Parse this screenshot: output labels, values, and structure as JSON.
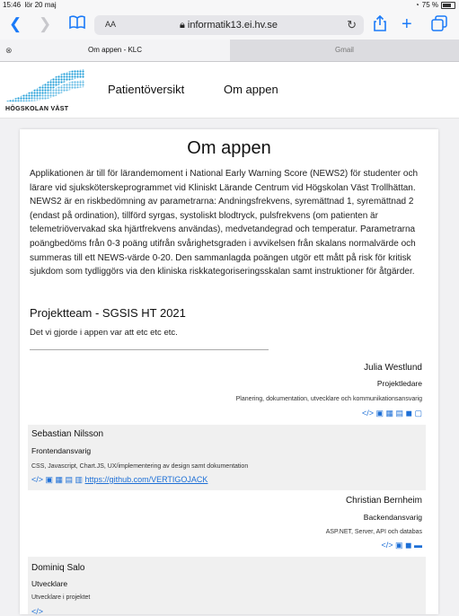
{
  "status_bar": {
    "time": "15:46",
    "date": "lör 20 maj",
    "battery": "75 %"
  },
  "toolbar": {
    "text_size": "AA",
    "url": "informatik13.ei.hv.se"
  },
  "tabs": [
    {
      "label": "Om appen - KLC",
      "active": true
    },
    {
      "label": "Gmail",
      "active": false
    }
  ],
  "site": {
    "logo_text": "HÖGSKOLAN VÄST",
    "nav": [
      "Patientöversikt",
      "Om appen"
    ]
  },
  "page": {
    "title": "Om appen",
    "intro": "Applikationen är till för lärandemoment i National Early Warning Score (NEWS2) för studenter och lärare vid sjuksköterskeprogrammet vid Kliniskt Lärande Centrum vid Högskolan Väst Trollhättan. NEWS2 är en riskbedömning av parametrarna: Andningsfrekvens, syremättnad 1, syremättnad 2 (endast på ordination), tillförd syrgas, systoliskt blodtryck, pulsfrekvens (om patienten är telemetriövervakad ska hjärtfrekvens användas), medvetandegrad och temperatur. Parametrarna poängbedöms från 0-3 poäng utifrån svårighetsgraden i avvikelsen från skalans normalvärde och summeras till ett NEWS-värde 0-20. Den sammanlagda poängen utgör ett mått på risk för kritisk sjukdom som tydliggörs via den kliniska riskkategoriseringsskalan samt instruktioner för åtgärder.",
    "team_heading": "Projektteam - SGSIS HT 2021",
    "team_subtext": "Det vi gjorde i appen var att etc etc etc."
  },
  "team": [
    {
      "name": "Julia Westlund",
      "role": "Projektledare",
      "desc": "Planering, dokumentation, utvecklare och kommunikationsansvarig",
      "icons": "</> ▣ ▦ ▤ ◼ ▢",
      "link": ""
    },
    {
      "name": "Sebastian Nilsson",
      "role": "Frontendansvarig",
      "desc": "CSS, Javascript, Chart.JS, UX/implementering av design samt dokumentation",
      "icons": "</> ▣ ▦ ▤ ▥",
      "link": "https://github.com/VERTIGOJACK"
    },
    {
      "name": "Christian Bernheim",
      "role": "Backendansvarig",
      "desc": "ASP.NET, Server, API och databas",
      "icons": "</> ▣ ◼ ▬",
      "link": ""
    },
    {
      "name": "Dominiq Salo",
      "role": "Utvecklare",
      "desc": "Utvecklare i projektet",
      "icons": "</>",
      "link": ""
    }
  ]
}
